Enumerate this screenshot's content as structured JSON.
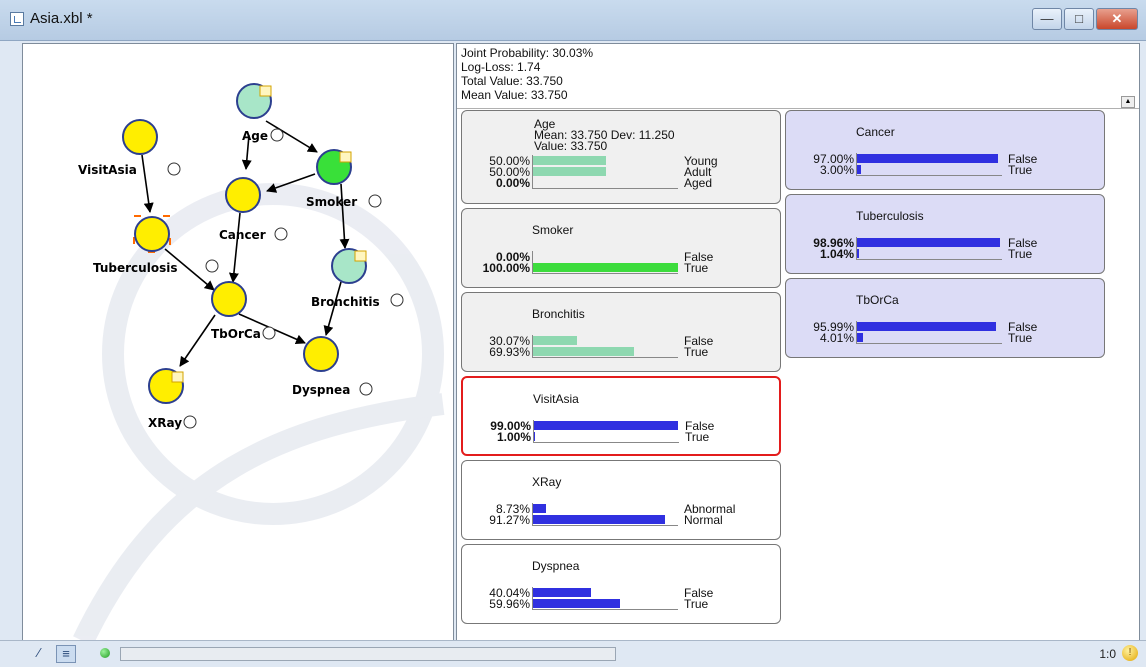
{
  "window": {
    "title": "Asia.xbl *"
  },
  "stats": {
    "joint": "Joint Probability: 30.03%",
    "logloss": "Log-Loss: 1.74",
    "total": "Total Value: 33.750",
    "mean": "Mean Value: 33.750"
  },
  "graph": {
    "nodes": [
      {
        "label": "VisitAsia",
        "color": "#ffee00"
      },
      {
        "label": "Age",
        "color": "#a8e6c8"
      },
      {
        "label": "Smoker",
        "color": "#39e039"
      },
      {
        "label": "Cancer",
        "color": "#ffee00"
      },
      {
        "label": "Tuberculosis",
        "color": "#ffee00"
      },
      {
        "label": "Bronchitis",
        "color": "#a8e6c8"
      },
      {
        "label": "TbOrCa",
        "color": "#ffee00"
      },
      {
        "label": "Dyspnea",
        "color": "#ffee00"
      },
      {
        "label": "XRay",
        "color": "#ffee00"
      }
    ]
  },
  "monitors": {
    "age": {
      "title": "Age",
      "stats": "Mean: 33.750 Dev: 11.250",
      "value": "Value: 33.750",
      "rows": [
        {
          "pct": "50.00%",
          "label": "Young",
          "value": 50.0,
          "bold": false
        },
        {
          "pct": "50.00%",
          "label": "Adult",
          "value": 50.0,
          "bold": false
        },
        {
          "pct": "0.00%",
          "label": "Aged",
          "value": 0.0,
          "bold": true
        }
      ]
    },
    "smoker": {
      "title": "Smoker",
      "rows": [
        {
          "pct": "0.00%",
          "label": "False",
          "value": 0.0,
          "bold": true
        },
        {
          "pct": "100.00%",
          "label": "True",
          "value": 100.0,
          "bold": true
        }
      ]
    },
    "bronchitis": {
      "title": "Bronchitis",
      "rows": [
        {
          "pct": "30.07%",
          "label": "False",
          "value": 30.07,
          "bold": false
        },
        {
          "pct": "69.93%",
          "label": "True",
          "value": 69.93,
          "bold": false
        }
      ]
    },
    "visitasia": {
      "title": "VisitAsia",
      "rows": [
        {
          "pct": "99.00%",
          "label": "False",
          "value": 99.0,
          "bold": true
        },
        {
          "pct": "1.00%",
          "label": "True",
          "value": 1.0,
          "bold": true
        }
      ]
    },
    "xray": {
      "title": "XRay",
      "rows": [
        {
          "pct": "8.73%",
          "label": "Abnormal",
          "value": 8.73,
          "bold": false
        },
        {
          "pct": "91.27%",
          "label": "Normal",
          "value": 91.27,
          "bold": false
        }
      ]
    },
    "dyspnea": {
      "title": "Dyspnea",
      "rows": [
        {
          "pct": "40.04%",
          "label": "False",
          "value": 40.04,
          "bold": false
        },
        {
          "pct": "59.96%",
          "label": "True",
          "value": 59.96,
          "bold": false
        }
      ]
    },
    "cancer": {
      "title": "Cancer",
      "rows": [
        {
          "pct": "97.00%",
          "label": "False",
          "value": 97.0,
          "bold": false
        },
        {
          "pct": "3.00%",
          "label": "True",
          "value": 3.0,
          "bold": false
        }
      ]
    },
    "tuberculosis": {
      "title": "Tuberculosis",
      "rows": [
        {
          "pct": "98.96%",
          "label": "False",
          "value": 98.96,
          "bold": true
        },
        {
          "pct": "1.04%",
          "label": "True",
          "value": 1.04,
          "bold": true
        }
      ]
    },
    "tborca": {
      "title": "TbOrCa",
      "rows": [
        {
          "pct": "95.99%",
          "label": "False",
          "value": 95.99,
          "bold": false
        },
        {
          "pct": "4.01%",
          "label": "True",
          "value": 4.01,
          "bold": false
        }
      ]
    }
  },
  "statusbar": {
    "zoom": "1:0"
  },
  "colors": {
    "green_bar": "#3cdc3c",
    "teal_bar": "#8ed8b0",
    "blue_bar": "#3030e0"
  }
}
